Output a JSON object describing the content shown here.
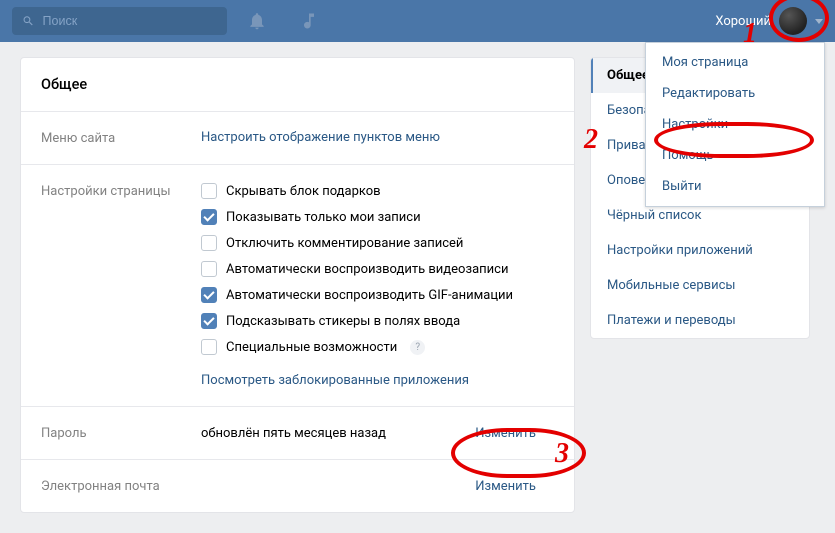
{
  "top": {
    "search_placeholder": "Поиск",
    "username": "Хороший"
  },
  "page": {
    "title": "Общее"
  },
  "menu_row": {
    "label": "Меню сайта",
    "action": "Настроить отображение пунктов меню"
  },
  "page_settings": {
    "label": "Настройки страницы",
    "items": [
      {
        "label": "Скрывать блок подарков",
        "checked": false
      },
      {
        "label": "Показывать только мои записи",
        "checked": true
      },
      {
        "label": "Отключить комментирование записей",
        "checked": false
      },
      {
        "label": "Автоматически воспроизводить видеозаписи",
        "checked": false
      },
      {
        "label": "Автоматически воспроизводить GIF-анимации",
        "checked": true
      },
      {
        "label": "Подсказывать стикеры в полях ввода",
        "checked": true
      },
      {
        "label": "Специальные возможности",
        "checked": false,
        "help": true
      }
    ],
    "blocked_link": "Посмотреть заблокированные приложения"
  },
  "password": {
    "label": "Пароль",
    "value": "обновлён пять месяцев назад",
    "action": "Изменить"
  },
  "email": {
    "label": "Электронная почта",
    "action": "Изменить"
  },
  "side": {
    "items": [
      "Общее",
      "Безопасность",
      "Приватность",
      "Оповещения",
      "Чёрный список",
      "Настройки приложений",
      "Мобильные сервисы",
      "Платежи и переводы"
    ]
  },
  "dropdown": {
    "items": [
      "Моя страница",
      "Редактировать",
      "Настройки",
      "Помощь",
      "Выйти"
    ]
  },
  "annotations": {
    "n1": "1",
    "n2": "2",
    "n3": "3"
  }
}
